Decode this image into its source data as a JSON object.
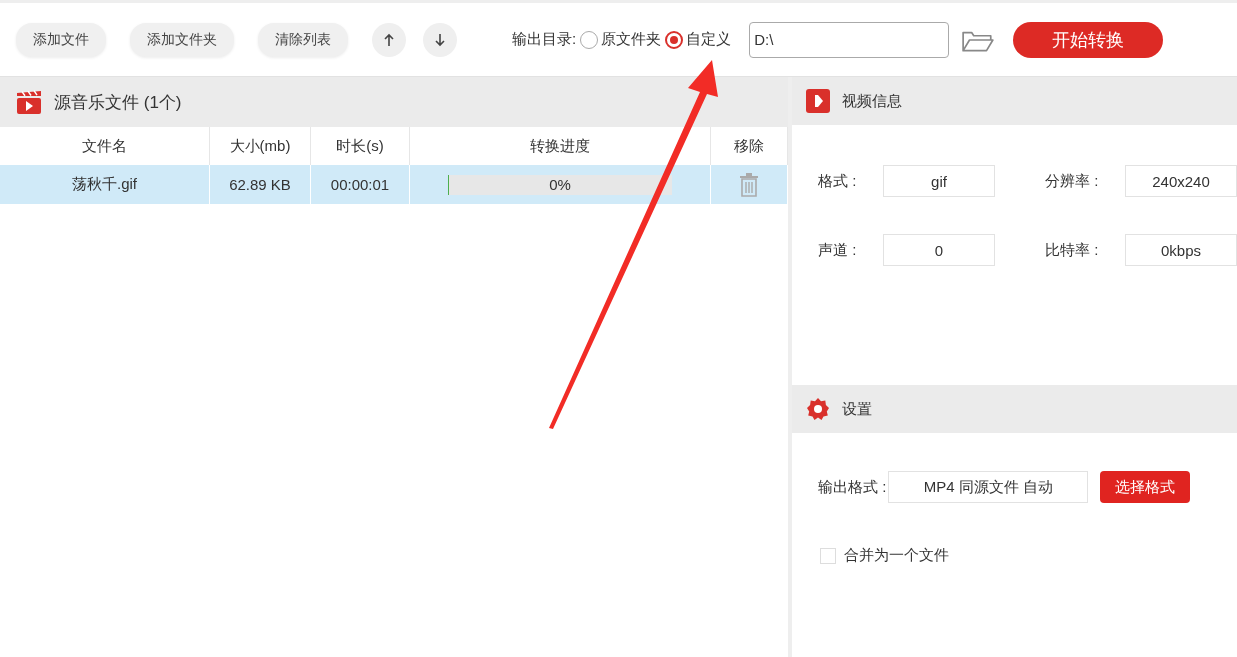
{
  "toolbar": {
    "buttons": [
      "添加文件",
      "添加文件夹",
      "清除列表"
    ],
    "move_buttons": [
      {
        "kind": "up"
      },
      {
        "kind": "down"
      }
    ],
    "output_dir": {
      "label": "输出目录:",
      "options": [
        {
          "label": "原文件夹",
          "selected": false
        },
        {
          "label": "自定义",
          "selected": true
        }
      ],
      "path": "D:\\"
    },
    "start_button": "开始转换"
  },
  "file_list": {
    "title": "源音乐文件 (1个)",
    "columns": [
      "文件名",
      "大小(mb)",
      "时长(s)",
      "转换进度",
      "移除"
    ],
    "rows": [
      {
        "name": "荡秋千.gif",
        "size": "62.89 KB",
        "duration": "00:00:01",
        "level": 0,
        "progress": "0%",
        "selected": true
      }
    ]
  },
  "video_info": {
    "title": "视频信息",
    "fields": [
      {
        "label": "格式 :",
        "value": "gif"
      },
      {
        "label": "分辨率 :",
        "value": "240x240"
      },
      {
        "label": "声道 :",
        "value": "0"
      },
      {
        "label": "比特率 :",
        "value": "0kbps"
      }
    ]
  },
  "settings": {
    "title": "设置",
    "output_format": {
      "label": "输出格式 :",
      "value": "MP4 同源文件 自动",
      "button": "选择格式"
    },
    "merge": {
      "label": "合并为一个文件",
      "checked": false
    }
  }
}
